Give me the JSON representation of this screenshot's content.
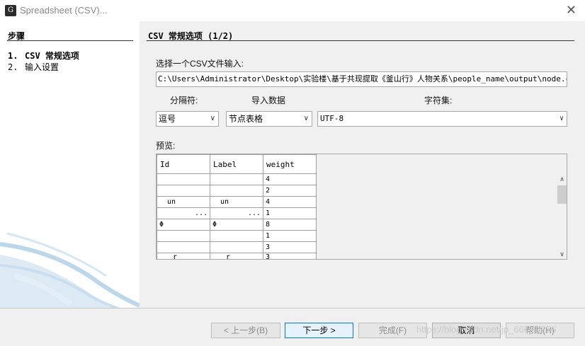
{
  "window": {
    "title": "Spreadsheet (CSV)...",
    "app_icon_glyph": "G",
    "close_glyph": "✕"
  },
  "steps": {
    "title": "步骤",
    "items": [
      {
        "num": "1.",
        "label": "CSV 常规选项"
      },
      {
        "num": "2.",
        "label": "输入设置"
      }
    ]
  },
  "main": {
    "title": "CSV 常规选项 (1/2)",
    "file_label": "选择一个CSV文件输入:",
    "file_path": "C:\\Users\\Administrator\\Desktop\\实验楼\\基于共现提取《釜山行》人物关系\\people_name\\output\\node.csv",
    "separator_label": "分隔符:",
    "import_label": "导入数据",
    "charset_label": "字符集:",
    "separator_value": "逗号",
    "import_value": "节点表格",
    "charset_value": "UTF-8",
    "preview_label": "预览:"
  },
  "preview_table": {
    "columns": [
      "Id",
      "Label",
      "weight"
    ],
    "rows": [
      [
        "",
        "",
        "4"
      ],
      [
        "",
        "",
        "2"
      ],
      [
        "un",
        "un",
        "4"
      ],
      [
        "...",
        "...",
        "1"
      ],
      [
        "Φ",
        "Φ",
        "8"
      ],
      [
        "",
        "",
        "1"
      ],
      [
        "",
        "",
        "3"
      ],
      [
        "r",
        "r",
        "3"
      ]
    ]
  },
  "buttons": {
    "prev": "< 上一步(B)",
    "next": "下一步 >",
    "finish": "完成(F)",
    "cancel": "取消",
    "help": "帮助(H)"
  },
  "watermark": "https://blog.csdn.net/jp_666xiu256",
  "colors": {
    "panel_bg": "#f0f0f0",
    "primary_border": "#0078d7",
    "swoosh": "#bcd6ea"
  }
}
